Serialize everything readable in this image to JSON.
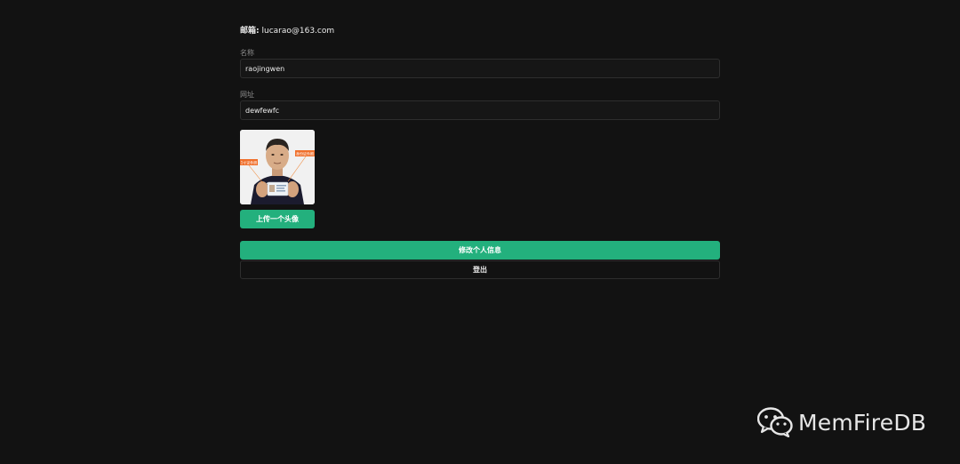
{
  "account": {
    "email_label": "邮箱:",
    "email_value": "lucarao@163.com"
  },
  "form": {
    "name_label": "名称",
    "name_value": "raojingwen",
    "website_label": "网址",
    "website_value": "dewfewfc"
  },
  "avatar": {
    "upload_label": "上传一个头像",
    "photo_sign_left": "1寸证件照",
    "photo_sign_right": "身份证件照"
  },
  "actions": {
    "update_label": "修改个人信息",
    "logout_label": "登出"
  },
  "watermark": {
    "icon": "wechat-icon",
    "text": "MemFireDB"
  },
  "colors": {
    "background": "#121212",
    "accent": "#23b07d",
    "input_border": "#2e2e2e"
  }
}
